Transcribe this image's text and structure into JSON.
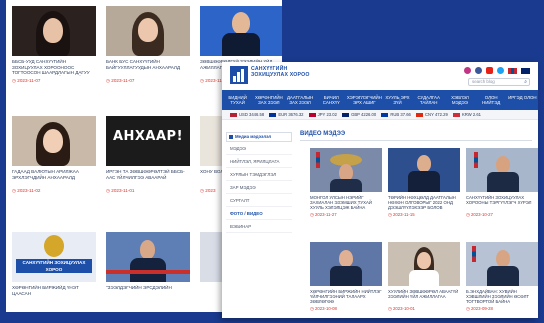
{
  "back": {
    "cards": [
      {
        "caption": "ББСБ-ууд Санхүүгийн зохицуулах хорооноос тогтоосон шаардлагын дагуу зээл олголтоо хийх ёстой",
        "date": "2023-11-07"
      },
      {
        "caption": "БАНК БУС САНХҮҮГИЙН БАЙГУУЛЛАГУУДЫН АНХААРАЛД",
        "date": "2023-11-07"
      },
      {
        "caption": "ЗӨВШӨӨРӨЛГҮЙ ЗЭЭЛИЙН ҮЙЛ АЖИЛЛАГАА ЭРХЛЭХГҮЙ БАЙХ",
        "date": "2023-11-0"
      },
      {
        "caption": "ГАДААД ВАЛЮТЫН АРИЛЖАА ЭРХЛЭГЧДИЙН АНХААРАЛД",
        "date": "2023-11-02"
      },
      {
        "caption": "Иргэн та зөвшөөрөлтэй ББСБ-аас үйлчилгээ аваарай",
        "date": "2023-11-01"
      },
      {
        "caption": "ХОНУ ВОЛОН СЭТГ",
        "date": "2023"
      },
      {
        "caption": "ХӨРӨНГИЙН БИРЖИЙД ҮНЭТ ЦААСАН",
        "date": ""
      },
      {
        "caption": "\"ЗЭЭЛДЭГЧИЙН ЭРСДЭЛИЙН",
        "date": ""
      },
      {
        "caption": "",
        "date": ""
      }
    ],
    "alert_text": "АНХААР!",
    "banner_text": "САНХҮҮГИЙН ЗОХИЦУУЛАХ ХОРОО"
  },
  "front": {
    "logo_text": "САНХҮҮГИЙН ЗОХИЦУУЛАХ ХОРОО",
    "social": [
      "instagram",
      "facebook",
      "youtube",
      "twitter"
    ],
    "search_placeholder": "search blog",
    "nav": [
      "БИДНИЙ ТУХАЙ",
      "ХӨРӨНГИЙН ЗАХ ЗЭЭЛ",
      "ДААТГАЛЫН ЗАХ ЗЭЭЛ",
      "БИЧИЛ САНХҮҮ",
      "ХЭРЭГЛЭГЧИЙН ЭРХ АШИГ",
      "ХУУЛЬ ЭРХ ЗҮЙ",
      "СУДАЛГАА ТАЙЛАН",
      "ХЭВЛЭЛ МЭДЭЭ",
      "ОЛОН НИЙТЭД",
      "ИРГЭД ОЛОН"
    ],
    "ticker": [
      {
        "code": "USD",
        "value": "3446.58",
        "color": "#b22234"
      },
      {
        "code": "EUR",
        "value": "3676.32",
        "color": "#003399"
      },
      {
        "code": "JPY",
        "value": "23.02",
        "color": "#bc002d"
      },
      {
        "code": "GBP",
        "value": "4226.00",
        "color": "#012169"
      },
      {
        "code": "RUB",
        "value": "37.66",
        "color": "#0039a6"
      },
      {
        "code": "CNY",
        "value": "472.29",
        "color": "#de2910"
      },
      {
        "code": "KRW",
        "value": "2.61",
        "color": "#cd2e3a"
      }
    ],
    "sidebar": {
      "heading": "Медиа мэдээлэл",
      "items": [
        "Мэдээ",
        "Нийтлэл, ярилцлага",
        "Хурлын тэмдэглэл",
        "Зар мэдээ",
        "Сургалт",
        "Фото / видео",
        "Вэбинар"
      ],
      "active_index": 5
    },
    "section_title": "ВИДЕО МЭДЭЭ",
    "cards": [
      {
        "caption": "МОНГОЛ УЛСЫН НЭРИЙГ ЗАХИАЛАН ЭЗЭМШИХ ТУХАЙ ХУУЛЬ ХЭЛЭЛЦЭЖ БАЙНА",
        "date": "2023-11-27"
      },
      {
        "caption": "Төрийн нөхцөлд даатгалын нөхөн олговорыг 2022 онд дээшлүүлэхээр болов",
        "date": "2023-11-15"
      },
      {
        "caption": "САНХҮҮГИЙН ЗОХИЦУУЛАХ ХОРООНЫ ТЭРГҮҮЛЭГЧ ХҮРЭЛ",
        "date": "2023-10-27"
      },
      {
        "caption": "ХӨРӨНГИЙН БИРЖИЙН НИЙТЛЭГ ҮЙЛЧИЛГЭЭНИЙ ТАЛААРХ ЗӨВЛӨГӨӨ",
        "date": "2023-10-08"
      },
      {
        "caption": "ХУУЛИЙН ЗӨВШӨӨРӨЛ АВААГҮЙ ЗЭЭЛИЙН ҮЙЛ АЖИЛЛАГАА",
        "date": "2023-10-01"
      },
      {
        "caption": "Б.ЭНХДАЙВАН: ХУВИЙН ХЭВШЛИЙН ЗЭЭЛИЙН ӨСӨЛТ ТОГТВОРТОЙ БАЙНА",
        "date": "2023-09-28"
      }
    ]
  }
}
